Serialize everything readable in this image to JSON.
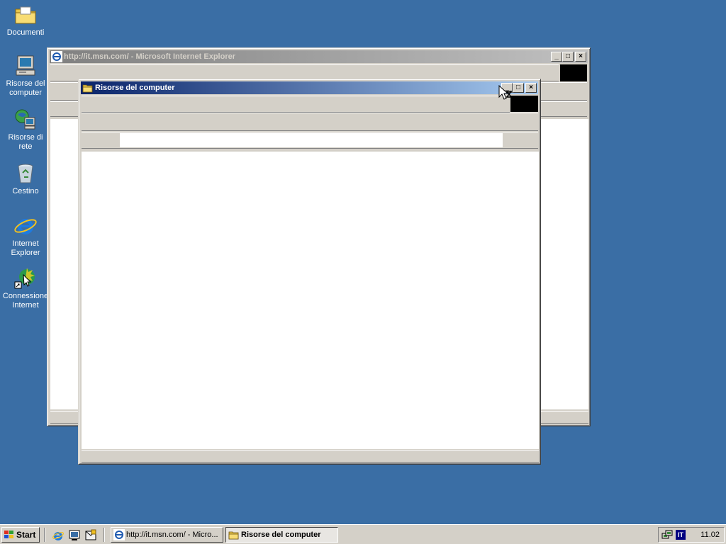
{
  "desktop": {
    "background": "#3a6ea5",
    "icons": [
      {
        "label": "Documenti",
        "icon": "folder-icon"
      },
      {
        "label": "Risorse del computer",
        "icon": "computer-icon"
      },
      {
        "label": "Risorse di rete",
        "icon": "network-icon"
      },
      {
        "label": "Cestino",
        "icon": "recycle-bin-icon"
      },
      {
        "label": "Internet Explorer",
        "icon": "ie-icon"
      },
      {
        "label": "Connessione Internet",
        "icon": "connection-icon"
      }
    ]
  },
  "ie_window": {
    "title": "http://it.msn.com/ - Microsoft Internet Explorer",
    "state": "inactive",
    "buttons": {
      "minimize": "_",
      "maximize": "□",
      "close": "×"
    }
  },
  "explorer_window": {
    "title": "Risorse del computer",
    "state": "active",
    "buttons": {
      "minimize": "_",
      "maximize": "□",
      "close": "×"
    },
    "address_value": ""
  },
  "taskbar": {
    "start_label": "Start",
    "quick_launch": [
      "ie-icon",
      "desktop-icon",
      "outlook-icon"
    ],
    "tasks": [
      {
        "label": "http://it.msn.com/ - Micro...",
        "icon": "ie-icon",
        "pressed": false
      },
      {
        "label": "Risorse del computer",
        "icon": "folder-icon",
        "pressed": true
      }
    ],
    "tray": {
      "icon": "network-tray-icon",
      "language": "IT",
      "clock": "11.02"
    }
  },
  "colors": {
    "active_title_start": "#0a246a",
    "active_title_end": "#a6caf0",
    "inactive_title_start": "#808080",
    "inactive_title_end": "#c0c0c0",
    "face": "#d4d0c8"
  }
}
